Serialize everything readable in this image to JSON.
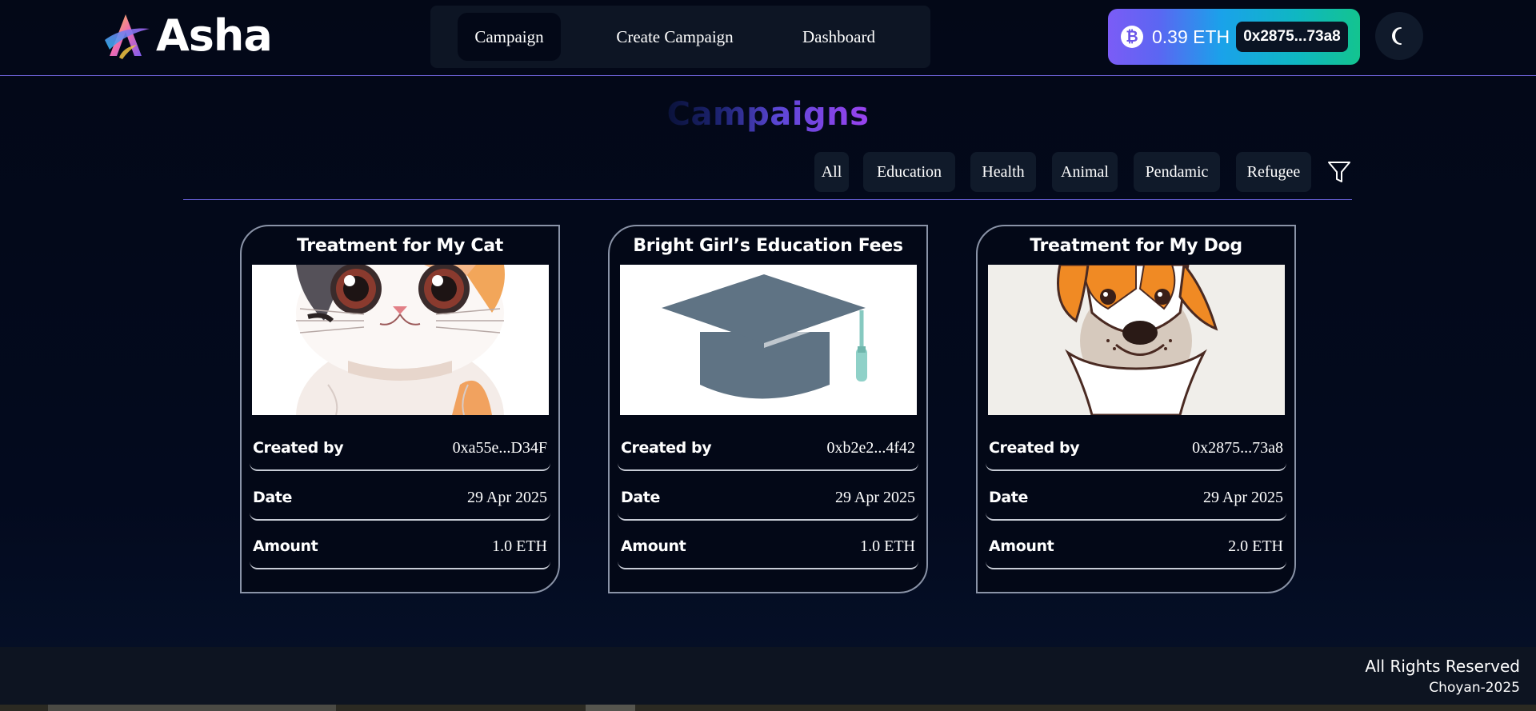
{
  "app": {
    "name": "Asha"
  },
  "nav": {
    "items": [
      {
        "label": "Campaign",
        "active": true
      },
      {
        "label": "Create Campaign",
        "active": false
      },
      {
        "label": "Dashboard",
        "active": false
      }
    ]
  },
  "wallet": {
    "icon": "bitcoin-icon",
    "balance": "0.39 ETH",
    "address": "0x2875...73a8"
  },
  "theme_toggle": {
    "icon": "moon-icon"
  },
  "page": {
    "title": "Campaigns"
  },
  "filters": {
    "chips": [
      "All",
      "Education",
      "Health",
      "Animal",
      "Pendamic",
      "Refugee"
    ],
    "icon": "filter-icon"
  },
  "campaigns": [
    {
      "title": "Treatment for My Cat",
      "image": "cat-illustration",
      "created_by_label": "Created by",
      "created_by": "0xa55e...D34F",
      "date_label": "Date",
      "date": "29 Apr 2025",
      "amount_label": "Amount",
      "amount": "1.0 ETH"
    },
    {
      "title": "Bright Girl’s Education Fees",
      "image": "graduation-cap-illustration",
      "created_by_label": "Created by",
      "created_by": "0xb2e2...4f42",
      "date_label": "Date",
      "date": "29 Apr 2025",
      "amount_label": "Amount",
      "amount": "1.0 ETH"
    },
    {
      "title": "Treatment for My Dog",
      "image": "dog-illustration",
      "created_by_label": "Created by",
      "created_by": "0x2875...73a8",
      "date_label": "Date",
      "date": "29 Apr 2025",
      "amount_label": "Amount",
      "amount": "2.0 ETH"
    }
  ],
  "footer": {
    "line1": "All Rights Reserved",
    "line2": "Choyan-2025"
  },
  "colors": {
    "background": "#030817",
    "accent_line": "#6f63d9",
    "wallet_gradient_start": "#7b5cf6",
    "wallet_gradient_end": "#13c48f",
    "title_gradient_end": "#9a43f0"
  }
}
